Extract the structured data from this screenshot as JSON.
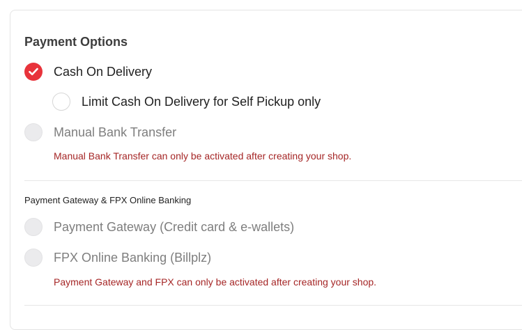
{
  "section": {
    "title": "Payment Options"
  },
  "options": {
    "cod": {
      "label": "Cash On Delivery",
      "checked": true
    },
    "cod_self_pickup": {
      "label": "Limit Cash On Delivery for Self Pickup only",
      "checked": false
    },
    "bank_transfer": {
      "label": "Manual Bank Transfer",
      "disabled": true
    },
    "bank_transfer_notice": "Manual Bank Transfer can only be activated after creating your shop."
  },
  "gateway_section": {
    "title": "Payment Gateway & FPX Online Banking",
    "payment_gateway": {
      "label": "Payment Gateway (Credit card & e-wallets)",
      "disabled": true
    },
    "fpx": {
      "label": "FPX Online Banking (Billplz)",
      "disabled": true
    },
    "notice": "Payment Gateway and FPX can only be activated after creating your shop."
  },
  "colors": {
    "accent": "#e8333b",
    "warning_text": "#a52626",
    "muted_text": "#7e7e7e"
  }
}
